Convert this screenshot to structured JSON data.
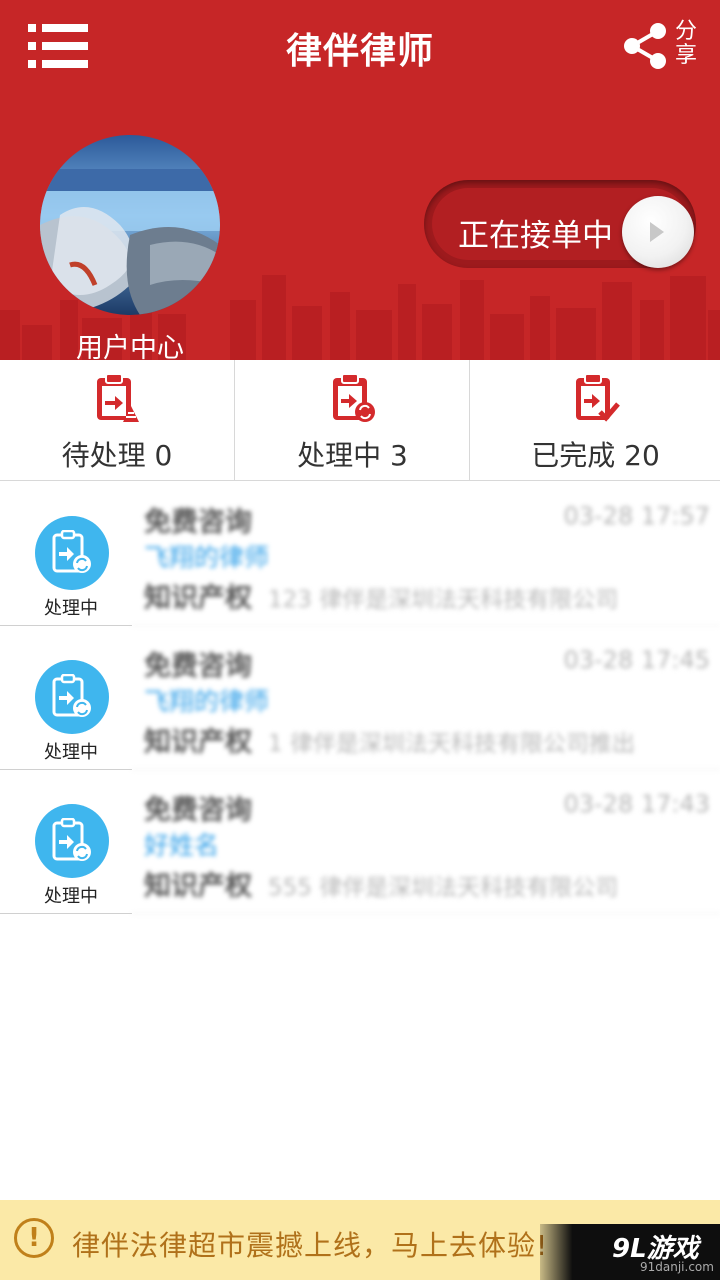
{
  "header": {
    "title": "律伴律师",
    "share_label": "分享"
  },
  "profile": {
    "user_center_label": "用户中心"
  },
  "order_toggle": {
    "label": "正在接单中",
    "state": "on"
  },
  "tabs": [
    {
      "label": "待处理 0",
      "icon": "clipboard-pending-icon"
    },
    {
      "label": "处理中 3",
      "icon": "clipboard-processing-icon"
    },
    {
      "label": "已完成 20",
      "icon": "clipboard-done-icon"
    }
  ],
  "orders": [
    {
      "status": "处理中",
      "title": "免费咨询",
      "time": "03-28 17:57",
      "name": "飞翔的律师",
      "category": "知识产权",
      "detail": "123 律伴是深圳法天科技有限公司"
    },
    {
      "status": "处理中",
      "title": "免费咨询",
      "time": "03-28 17:45",
      "name": "飞翔的律师",
      "category": "知识产权",
      "detail": "1 律伴是深圳法天科技有限公司推出"
    },
    {
      "status": "处理中",
      "title": "免费咨询",
      "time": "03-28 17:43",
      "name": "好姓名",
      "category": "知识产权",
      "detail": "555 律伴是深圳法天科技有限公司"
    }
  ],
  "banner": {
    "text": "律伴法律超市震撼上线，马上去体验!"
  },
  "watermark": {
    "logo": "9L游戏",
    "site": "91danji.com"
  },
  "colors": {
    "primary_red": "#c62627",
    "status_blue": "#3fb6ee",
    "banner_bg": "#fbe9a7",
    "banner_text": "#b0711a"
  }
}
